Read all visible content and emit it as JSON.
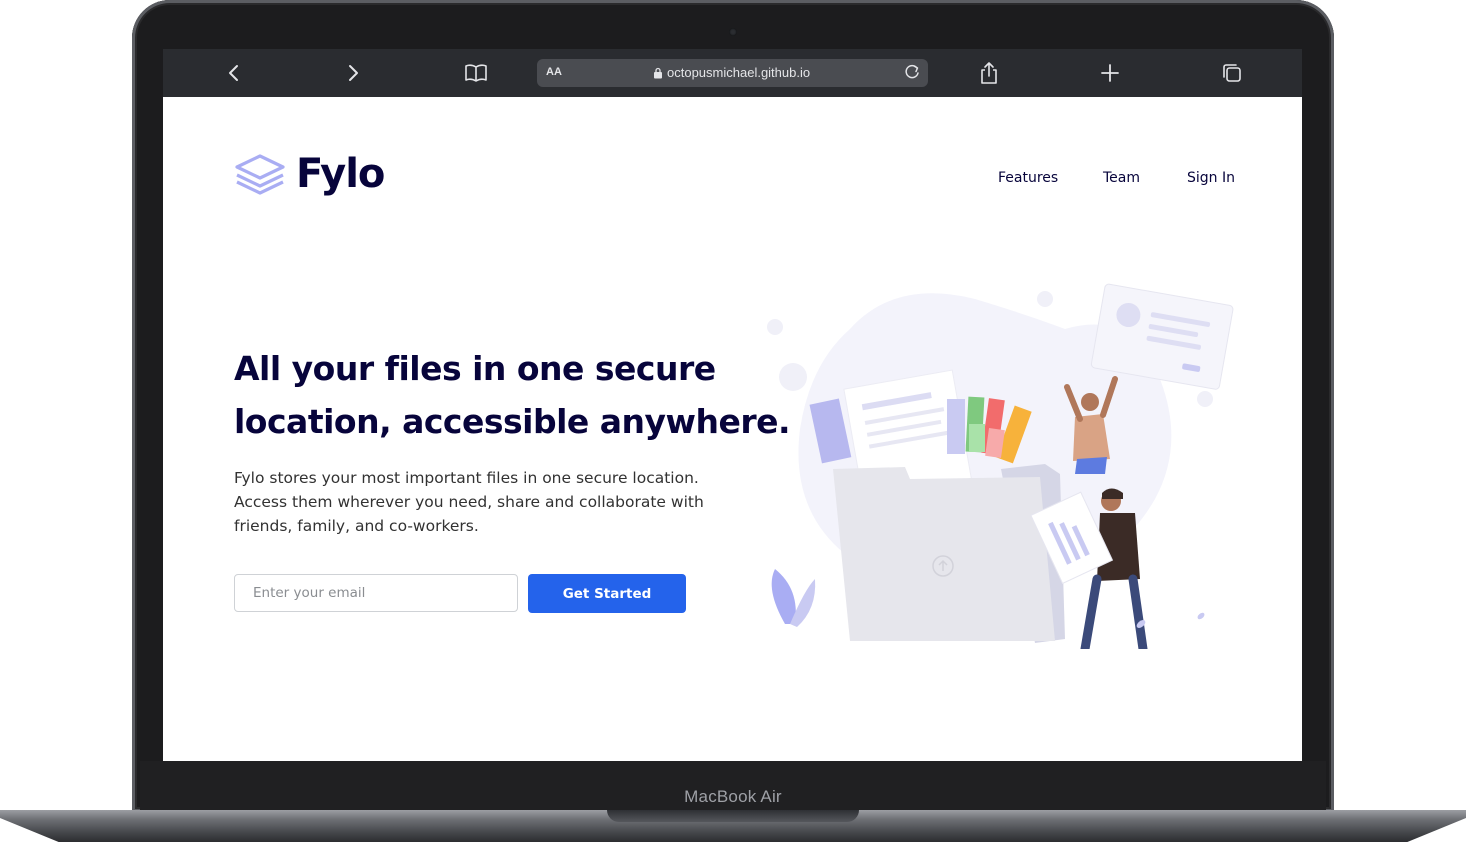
{
  "device": {
    "label": "MacBook Air"
  },
  "browser": {
    "reader_label": "AA",
    "url": "octopusmichael.github.io",
    "icons": [
      "back-icon",
      "forward-icon",
      "bookmarks-icon",
      "lock-icon",
      "reload-icon",
      "share-icon",
      "new-tab-icon",
      "tabs-icon"
    ]
  },
  "site": {
    "logo": "Fylo",
    "nav": [
      "Features",
      "Team",
      "Sign In"
    ]
  },
  "hero": {
    "title_line1": "All your files in one secure",
    "title_line2": "location, accessible anywhere.",
    "subtitle": "Fylo stores your most important files in one secure location. Access them wherever you need, share and collaborate with friends, family, and co-workers.",
    "email_placeholder": "Enter your email",
    "cta_label": "Get Started"
  },
  "colors": {
    "accent": "#2463eb",
    "heading": "#07043b",
    "logo": "#a9adf3"
  }
}
